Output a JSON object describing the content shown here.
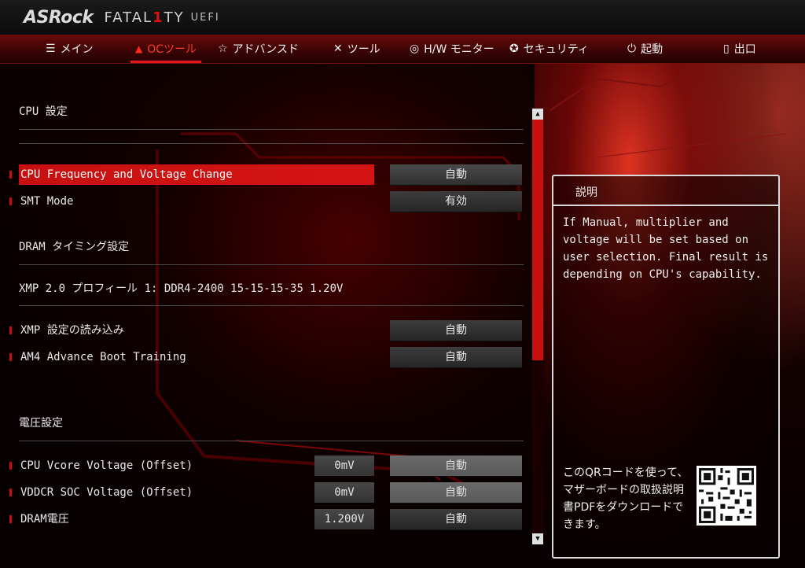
{
  "header": {
    "brand": "ASRock",
    "product_prefix": "FATAL",
    "product_one": "1",
    "product_suffix": "TY",
    "uefi": "UEFI"
  },
  "menu": [
    {
      "label": "メイン",
      "icon": "list-icon",
      "glyph": "☰"
    },
    {
      "label": "OCツール",
      "icon": "flame-icon",
      "glyph": "🔥"
    },
    {
      "label": "アドバンスド",
      "icon": "star-icon",
      "glyph": "☆"
    },
    {
      "label": "ツール",
      "icon": "tools-icon",
      "glyph": "✕"
    },
    {
      "label": "H/W モニター",
      "icon": "monitor-icon",
      "glyph": "◎"
    },
    {
      "label": "セキュリティ",
      "icon": "shield-icon",
      "glyph": "✪"
    },
    {
      "label": "起動",
      "icon": "power-icon",
      "glyph": "⏻"
    },
    {
      "label": "出口",
      "icon": "exit-icon",
      "glyph": "▯"
    }
  ],
  "active_tab": "OCツール",
  "sections": {
    "cpu": "CPU 設定",
    "dram": "DRAM タイミング設定",
    "voltage": "電圧設定"
  },
  "settings": {
    "cpu_freq": {
      "label": "CPU Frequency and Voltage Change",
      "value": "自動"
    },
    "smt": {
      "label": "SMT Mode",
      "value": "有効"
    },
    "xmp_profile": "XMP 2.0 プロフィール 1: DDR4-2400 15-15-15-35 1.20V",
    "xmp_load": {
      "label": "XMP 設定の読み込み",
      "value": "自動"
    },
    "am4_boot": {
      "label": "AM4 Advance Boot Training",
      "value": "自動"
    },
    "vcore": {
      "label": "CPU Vcore Voltage (Offset)",
      "num": "0mV",
      "value": "自動"
    },
    "vddcr": {
      "label": "VDDCR SOC Voltage (Offset)",
      "num": "0mV",
      "value": "自動"
    },
    "dram_v": {
      "label": "DRAM電圧",
      "num": "1.200V",
      "value": "自動"
    }
  },
  "description": {
    "title": "説明",
    "body": "If Manual, multiplier and voltage will be set based on user selection. Final result is depending on CPU's capability.",
    "qr_text": "このQRコードを使って、マザーボードの取扱説明書PDFをダウンロードできます。"
  },
  "colors": {
    "accent": "#d41414",
    "menu_bg": "#3c0404",
    "button": "#303030"
  }
}
